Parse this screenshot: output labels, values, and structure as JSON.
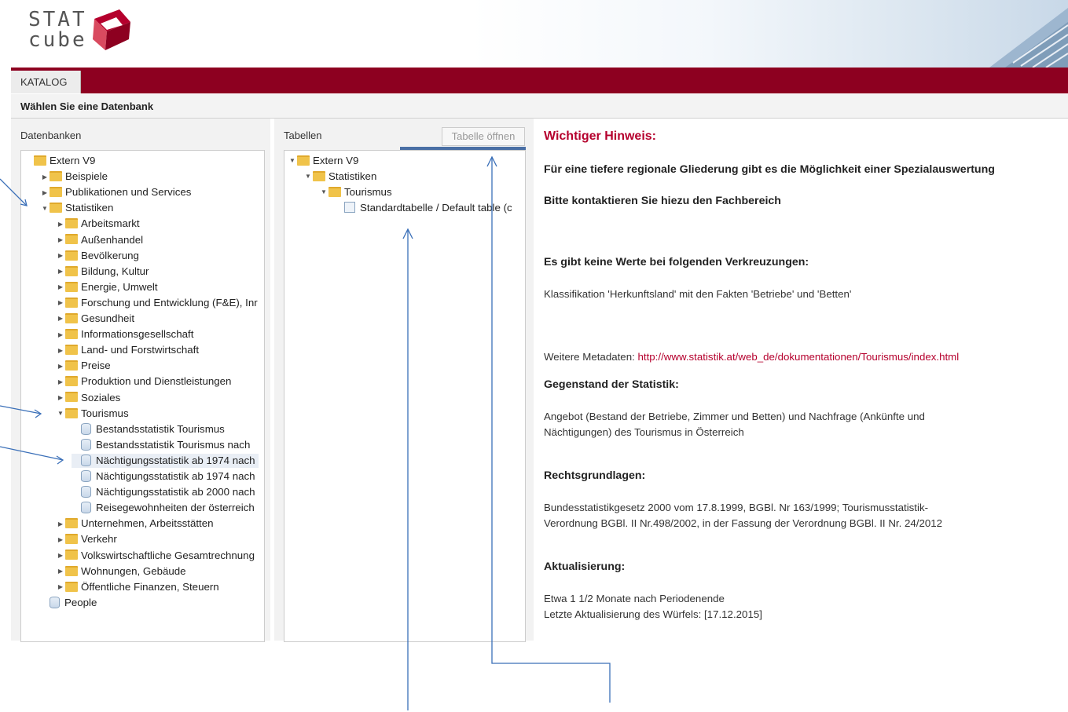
{
  "logo": {
    "line1": "STAT",
    "line2": "cube"
  },
  "nav": {
    "tab": "KATALOG"
  },
  "subbar": {
    "title": "Wählen Sie eine Datenbank"
  },
  "databases": {
    "title": "Datenbanken",
    "tree": [
      {
        "label": "Extern V9",
        "level": 0,
        "icon": "folder",
        "toggle": ""
      },
      {
        "label": "Beispiele",
        "level": 1,
        "icon": "folder",
        "toggle": "collapsed"
      },
      {
        "label": "Publikationen und Services",
        "level": 1,
        "icon": "folder",
        "toggle": "collapsed"
      },
      {
        "label": "Statistiken",
        "level": 1,
        "icon": "folder",
        "toggle": "expanded"
      },
      {
        "label": "Arbeitsmarkt",
        "level": 2,
        "icon": "folder",
        "toggle": "collapsed"
      },
      {
        "label": "Außenhandel",
        "level": 2,
        "icon": "folder",
        "toggle": "collapsed"
      },
      {
        "label": "Bevölkerung",
        "level": 2,
        "icon": "folder",
        "toggle": "collapsed"
      },
      {
        "label": "Bildung, Kultur",
        "level": 2,
        "icon": "folder",
        "toggle": "collapsed"
      },
      {
        "label": "Energie, Umwelt",
        "level": 2,
        "icon": "folder",
        "toggle": "collapsed"
      },
      {
        "label": "Forschung und Entwicklung (F&E), Inr",
        "level": 2,
        "icon": "folder",
        "toggle": "collapsed"
      },
      {
        "label": "Gesundheit",
        "level": 2,
        "icon": "folder",
        "toggle": "collapsed"
      },
      {
        "label": "Informationsgesellschaft",
        "level": 2,
        "icon": "folder",
        "toggle": "collapsed"
      },
      {
        "label": "Land- und Forstwirtschaft",
        "level": 2,
        "icon": "folder",
        "toggle": "collapsed"
      },
      {
        "label": "Preise",
        "level": 2,
        "icon": "folder",
        "toggle": "collapsed"
      },
      {
        "label": "Produktion und Dienstleistungen",
        "level": 2,
        "icon": "folder",
        "toggle": "collapsed"
      },
      {
        "label": "Soziales",
        "level": 2,
        "icon": "folder",
        "toggle": "collapsed"
      },
      {
        "label": "Tourismus",
        "level": 2,
        "icon": "folder",
        "toggle": "expanded"
      },
      {
        "label": "Bestandsstatistik Tourismus",
        "level": 3,
        "icon": "database",
        "toggle": ""
      },
      {
        "label": "Bestandsstatistik Tourismus nach",
        "level": 3,
        "icon": "database",
        "toggle": ""
      },
      {
        "label": "Nächtigungsstatistik ab 1974 nach",
        "level": 3,
        "icon": "database",
        "toggle": "",
        "selected": true
      },
      {
        "label": "Nächtigungsstatistik ab 1974 nach",
        "level": 3,
        "icon": "database",
        "toggle": ""
      },
      {
        "label": "Nächtigungsstatistik ab 2000 nach",
        "level": 3,
        "icon": "database",
        "toggle": ""
      },
      {
        "label": "Reisegewohnheiten der österreich",
        "level": 3,
        "icon": "database",
        "toggle": ""
      },
      {
        "label": "Unternehmen, Arbeitsstätten",
        "level": 2,
        "icon": "folder",
        "toggle": "collapsed"
      },
      {
        "label": "Verkehr",
        "level": 2,
        "icon": "folder",
        "toggle": "collapsed"
      },
      {
        "label": "Volkswirtschaftliche Gesamtrechnung",
        "level": 2,
        "icon": "folder",
        "toggle": "collapsed"
      },
      {
        "label": "Wohnungen, Gebäude",
        "level": 2,
        "icon": "folder",
        "toggle": "collapsed"
      },
      {
        "label": "Öffentliche Finanzen, Steuern",
        "level": 2,
        "icon": "folder",
        "toggle": "collapsed"
      },
      {
        "label": "People",
        "level": 1,
        "icon": "database",
        "toggle": ""
      }
    ]
  },
  "tables": {
    "title": "Tabellen",
    "open_button": "Tabelle öffnen",
    "tree": [
      {
        "label": "Extern V9",
        "level": 0,
        "icon": "folder",
        "toggle": "expanded"
      },
      {
        "label": "Statistiken",
        "level": 1,
        "icon": "folder",
        "toggle": "expanded"
      },
      {
        "label": "Tourismus",
        "level": 2,
        "icon": "folder",
        "toggle": "expanded"
      },
      {
        "label": "Standardtabelle / Default table (c",
        "level": 3,
        "icon": "table",
        "toggle": ""
      }
    ]
  },
  "info": {
    "notice_title": "Wichtiger Hinweis:",
    "notice_line1": "Für eine tiefere regionale Gliederung gibt es die Möglichkeit einer Spezialauswertung",
    "notice_line2": "Bitte kontaktieren Sie hiezu den Fachbereich",
    "no_values_title": "Es gibt keine Werte bei folgenden Verkreuzungen:",
    "no_values_text": "Klassifikation 'Herkunftsland' mit den Fakten 'Betriebe' und 'Betten'",
    "meta_label": "Weitere Metadaten:",
    "meta_link": "http://www.statistik.at/web_de/dokumentationen/Tourismus/index.html",
    "subject_title": "Gegenstand der Statistik:",
    "subject_line1": "Angebot (Bestand der Betriebe, Zimmer und Betten) und Nachfrage (Ankünfte und",
    "subject_line2": "Nächtigungen) des Tourismus in Österreich",
    "legal_title": "Rechtsgrundlagen:",
    "legal_line1": "Bundesstatistikgesetz 2000 vom 17.8.1999, BGBl. Nr 163/1999; Tourismusstatistik-",
    "legal_line2": "Verordnung BGBl. II Nr.498/2002, in der Fassung der Verordnung BGBl. II Nr. 24/2012",
    "update_title": "Aktualisierung:",
    "update_line1": "Etwa 1 1/2 Monate nach Periodenende",
    "update_line2": "Letzte Aktualisierung des Würfels: [17.12.2015]"
  },
  "colors": {
    "brand": "#8d0020",
    "accent_red": "#b5002d",
    "blue": "#4a6fa5"
  }
}
